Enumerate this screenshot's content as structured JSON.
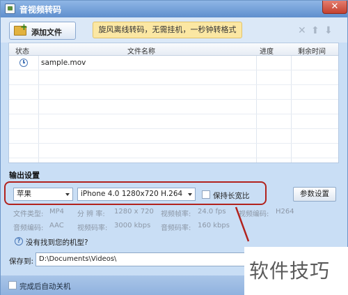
{
  "window": {
    "title": "音视频转码",
    "close_glyph": "✕"
  },
  "toolbar": {
    "add_file_label": "添加文件",
    "promo_text": "旋风离线转码，无需挂机，一秒钟转格式",
    "icons": [
      "delete-icon",
      "move-up-icon",
      "move-down-icon"
    ]
  },
  "file_table": {
    "columns": [
      "状态",
      "文件名称",
      "进度",
      "剩余时间"
    ],
    "rows": [
      {
        "status_icon": "clock-icon",
        "name": "sample.mov",
        "progress": "",
        "remaining": ""
      }
    ]
  },
  "output": {
    "section_label": "输出设置",
    "device": "苹果",
    "preset": "iPhone 4.0 1280x720 H.264",
    "keep_ratio_label": "保持长宽比",
    "keep_ratio_checked": false,
    "param_button": "参数设置",
    "info_row1": [
      {
        "label": "文件类型:",
        "value": "MP4"
      },
      {
        "label": "分 辨 率:",
        "value": "1280 x 720"
      },
      {
        "label": "视频帧率:",
        "value": "24.0 fps"
      },
      {
        "label": "视频编码:",
        "value": "H264"
      }
    ],
    "info_row2": [
      {
        "label": "音频编码:",
        "value": "AAC"
      },
      {
        "label": "视频码率:",
        "value": "3000 kbps"
      },
      {
        "label": "音频码率:",
        "value": "160 kbps"
      }
    ],
    "help_text": "没有找到您的机型?",
    "save_label": "保存到:",
    "save_path": "D:\\Documents\\Videos\\"
  },
  "footer": {
    "shutdown_label": "完成后自动关机",
    "shutdown_checked": false
  },
  "watermark": "软件技巧",
  "colors": {
    "highlight": "#b2221d",
    "title_bar": "#6f9bd4",
    "promo": "#fbe7a3"
  }
}
